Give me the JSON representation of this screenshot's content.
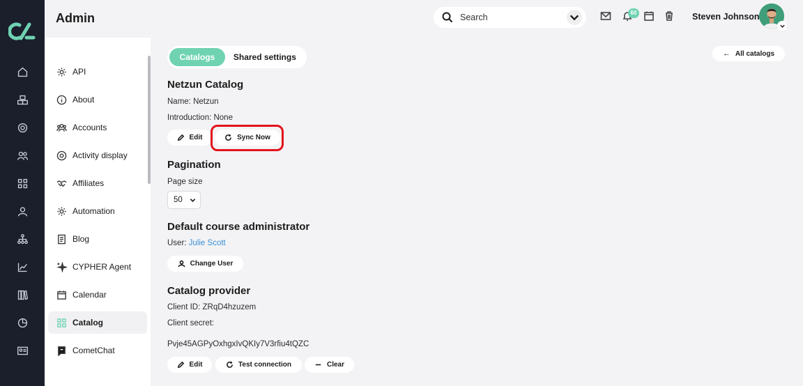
{
  "header": {
    "page_title": "Admin",
    "search_placeholder": "Search",
    "notifications_count": "60",
    "user_name": "Steven Johnson"
  },
  "sidebar": {
    "items": [
      {
        "label": "API",
        "icon": "gear-icon"
      },
      {
        "label": "About",
        "icon": "info-icon"
      },
      {
        "label": "Accounts",
        "icon": "users-icon"
      },
      {
        "label": "Activity display",
        "icon": "target-icon"
      },
      {
        "label": "Affiliates",
        "icon": "handshake-icon"
      },
      {
        "label": "Automation",
        "icon": "gear-icon"
      },
      {
        "label": "Blog",
        "icon": "document-icon"
      },
      {
        "label": "CYPHER Agent",
        "icon": "sparkle-icon"
      },
      {
        "label": "Calendar",
        "icon": "calendar-icon"
      },
      {
        "label": "Catalog",
        "icon": "grid-icon",
        "active": true
      },
      {
        "label": "CometChat",
        "icon": "chat-icon"
      }
    ]
  },
  "tabs": [
    {
      "label": "Catalogs",
      "active": true
    },
    {
      "label": "Shared settings",
      "active": false
    }
  ],
  "all_catalogs_label": "All catalogs",
  "catalog": {
    "title": "Netzun Catalog",
    "name_line": "Name: Netzun",
    "intro_line": "Introduction: None",
    "edit_label": "Edit",
    "sync_label": "Sync Now"
  },
  "pagination": {
    "title": "Pagination",
    "page_size_label": "Page size",
    "page_size_value": "50"
  },
  "admin": {
    "title": "Default course administrator",
    "user_prefix": "User: ",
    "user_name": "Julie Scott",
    "change_label": "Change User"
  },
  "provider": {
    "title": "Catalog provider",
    "client_id_line": "Client ID: ZRqD4hzuzem",
    "client_secret_label": "Client secret:",
    "client_secret_value": "Pvje45AGPyOxhgxIvQKIy7V3rfiu4tQZC",
    "edit_label": "Edit",
    "test_label": "Test connection",
    "clear_label": "Clear"
  },
  "colors": {
    "accent": "#6fd3b2",
    "rail": "#1b1f2c",
    "highlight": "#e3121b",
    "link": "#3a8fd6"
  }
}
